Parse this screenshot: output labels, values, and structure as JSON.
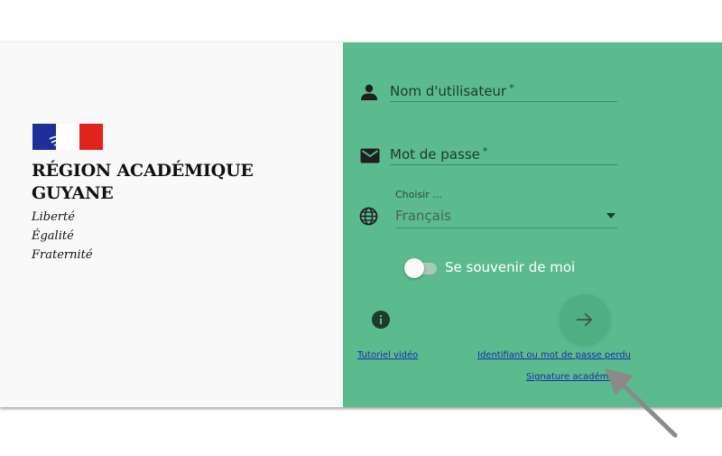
{
  "branding": {
    "region_line1": "RÉGION ACADÉMIQUE",
    "region_line2": "GUYANE",
    "motto": [
      "Liberté",
      "Égalité",
      "Fraternité"
    ],
    "colors": {
      "blue": "#1e2f9a",
      "white": "#ffffff",
      "red": "#e1231e"
    }
  },
  "login": {
    "username_label": "Nom d'utilisateur",
    "username_icon": "person-icon",
    "password_label": "Mot de passe",
    "password_icon": "email-icon",
    "required_mark": "*",
    "language_caption": "Choisir ...",
    "language_value": "Français",
    "language_icon": "globe-icon",
    "remember_label": "Se souvenir de moi",
    "remember_checked": false,
    "info_icon": "info-icon",
    "submit_icon": "arrow-right-icon",
    "accent_color": "#5cba8f"
  },
  "links": {
    "tutorial": "Tutoriel vidéo",
    "lost_credentials": "Identifiant ou mot de passe perdu",
    "signature": "Signature académique"
  }
}
